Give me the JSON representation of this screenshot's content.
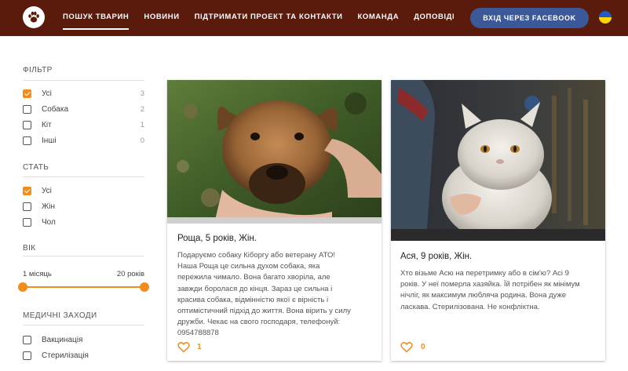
{
  "header": {
    "nav": [
      {
        "label": "ПОШУК ТВАРИН",
        "active": true
      },
      {
        "label": "НОВИНИ",
        "active": false
      },
      {
        "label": "ПІДТРИМАТИ ПРОЕКТ ТА КОНТАКТИ",
        "active": false
      },
      {
        "label": "КОМАНДА",
        "active": false
      },
      {
        "label": "ДОПОВІДІ",
        "active": false
      }
    ],
    "facebook_button": "ВХІД ЧЕРЕЗ FACEBOOK",
    "colors": {
      "bar": "#5a1a0c",
      "facebook": "#3b5998"
    },
    "icons": {
      "logo": "paw-icon",
      "language": "ukraine-flag-icon"
    }
  },
  "sidebar": {
    "filter": {
      "title": "ФІЛЬТР",
      "options": [
        {
          "label": "Усі",
          "count": "3",
          "checked": true
        },
        {
          "label": "Собака",
          "count": "2",
          "checked": false
        },
        {
          "label": "Кіт",
          "count": "1",
          "checked": false
        },
        {
          "label": "Інші",
          "count": "0",
          "checked": false
        }
      ]
    },
    "sex": {
      "title": "СТАТЬ",
      "options": [
        {
          "label": "Усі",
          "checked": true
        },
        {
          "label": "Жін",
          "checked": false
        },
        {
          "label": "Чол",
          "checked": false
        }
      ]
    },
    "age": {
      "title": "ВІК",
      "min_label": "1 місяць",
      "max_label": "20 років",
      "range": [
        0,
        1
      ]
    },
    "medical": {
      "title": "МЕДИЧНІ ЗАХОДИ",
      "options": [
        {
          "label": "Вакцинація",
          "checked": false
        },
        {
          "label": "Стерилізація",
          "checked": false
        }
      ]
    },
    "accent": "#f28c1c"
  },
  "cards": [
    {
      "title": "Роща, 5 років, Жін.",
      "text": "Подаруємо собаку Кіборгу або ветерану АТО! Наша Роща це сильна духом собака, яка пережила чимало. Вона багато хворіла, але завжди боролася до кінця. Зараз це сильна і красива собака, відмінністю якої є вірність і оптимістичний підхід до життя. Вона вірить у силу дружби. Чекає на свого господаря, телефонуй: 0954788878",
      "likes": "1",
      "image": "dog-photo",
      "like_icon": "heart-icon"
    },
    {
      "title": "Ася, 9 років, Жін.",
      "text": "Хто візьме Асю на перетримку або в сім'ю? Асі 9 років. У неї померла хазяйка. Їй потрібен як мінімум нічліг, як максимум любляча родина. Вона дуже ласкава. Стерилізована. Не конфліктна.",
      "likes": "0",
      "image": "cat-photo",
      "like_icon": "heart-icon"
    }
  ]
}
